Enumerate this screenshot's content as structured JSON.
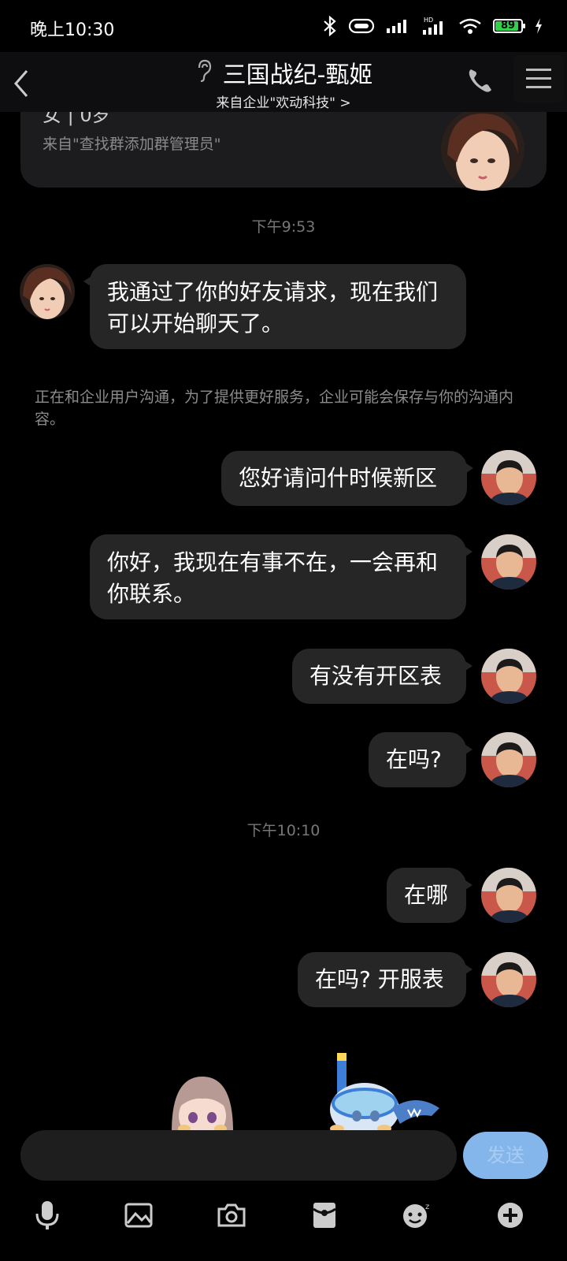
{
  "status_bar": {
    "time": "晚上10:30",
    "battery": "89"
  },
  "header": {
    "title": "三国战纪-甄姬",
    "subtitle": "来自企业\"欢动科技\" >"
  },
  "profile_card": {
    "partial_text": "女 | 0岁",
    "source": "来自\"查找群添加群管理员\""
  },
  "messages": [
    {
      "type": "timestamp",
      "text": "下午9:53"
    },
    {
      "type": "left",
      "text": "我通过了你的好友请求，现在我们可以开始聊天了。"
    },
    {
      "type": "notice",
      "text": "正在和企业用户沟通，为了提供更好服务，企业可能会保存与你的沟通内容。"
    },
    {
      "type": "right",
      "text": "您好请问什时候新区"
    },
    {
      "type": "right",
      "text": "你好，我现在有事不在，一会再和你联系。"
    },
    {
      "type": "right",
      "text": "有没有开区表"
    },
    {
      "type": "right",
      "text": "在吗?"
    },
    {
      "type": "timestamp",
      "text": "下午10:10"
    },
    {
      "type": "right",
      "text": "在哪"
    },
    {
      "type": "right",
      "text": "在吗? 开服表"
    }
  ],
  "input": {
    "placeholder": "",
    "send_label": "发送"
  },
  "toolbar": [
    "mic-icon",
    "image-icon",
    "camera-icon",
    "red-packet-icon",
    "emoji-icon",
    "plus-icon"
  ]
}
